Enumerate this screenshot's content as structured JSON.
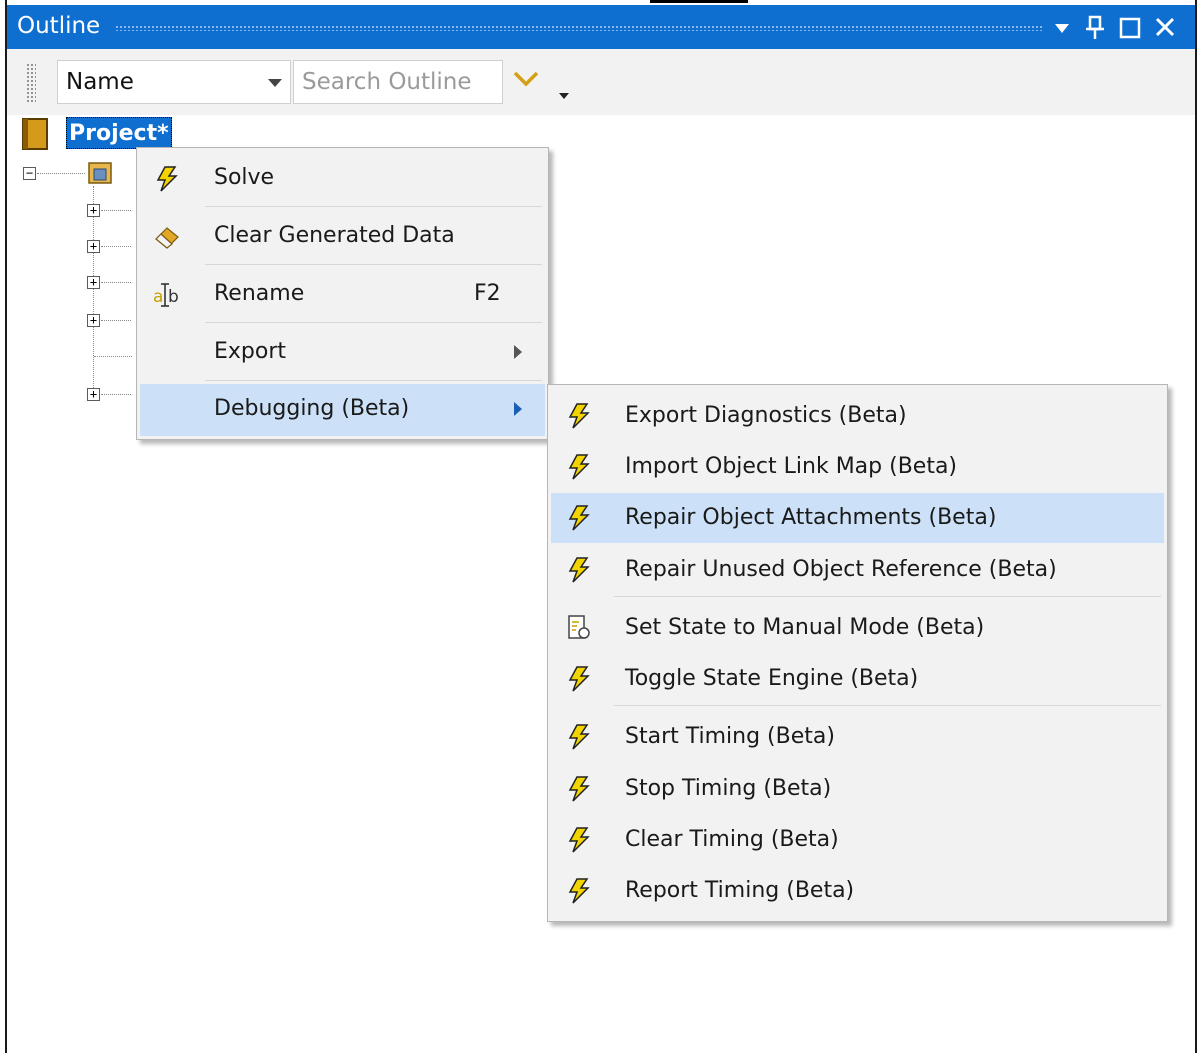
{
  "window": {
    "title": "Outline",
    "buttons": {
      "dropdown": "▼",
      "pin": "📌",
      "maximize": "☐",
      "close": "✕"
    }
  },
  "toolbar": {
    "sort_field": "Name",
    "search_placeholder": "Search Outline"
  },
  "tree": {
    "root_label": "Project*"
  },
  "context_menu": {
    "items": [
      {
        "label": "Solve",
        "icon": "lightning-icon"
      },
      {
        "label": "Clear Generated Data",
        "icon": "eraser-icon"
      },
      {
        "label": "Rename",
        "icon": "rename-icon",
        "shortcut": "F2"
      },
      {
        "label": "Export",
        "icon": "",
        "submenu": true
      },
      {
        "label": "Debugging (Beta)",
        "icon": "",
        "submenu": true,
        "highlighted": true
      }
    ]
  },
  "submenu": {
    "items": [
      {
        "label": "Export Diagnostics (Beta)",
        "icon": "lightning-icon"
      },
      {
        "label": "Import Object Link Map (Beta)",
        "icon": "lightning-icon"
      },
      {
        "label": "Repair Object Attachments (Beta)",
        "icon": "lightning-icon",
        "highlighted": true
      },
      {
        "label": "Repair Unused Object Reference (Beta)",
        "icon": "lightning-icon"
      },
      {
        "label": "Set State to Manual Mode (Beta)",
        "icon": "document-gear-icon"
      },
      {
        "label": "Toggle State Engine (Beta)",
        "icon": "lightning-icon"
      },
      {
        "label": "Start Timing (Beta)",
        "icon": "lightning-icon"
      },
      {
        "label": "Stop Timing (Beta)",
        "icon": "lightning-icon"
      },
      {
        "label": "Clear Timing (Beta)",
        "icon": "lightning-icon"
      },
      {
        "label": "Report Timing (Beta)",
        "icon": "lightning-icon"
      }
    ]
  },
  "colors": {
    "accent": "#0e6fd1",
    "menu_bg": "#f2f2f2",
    "highlight": "#cce1f7",
    "lightning": "#e2c400"
  }
}
